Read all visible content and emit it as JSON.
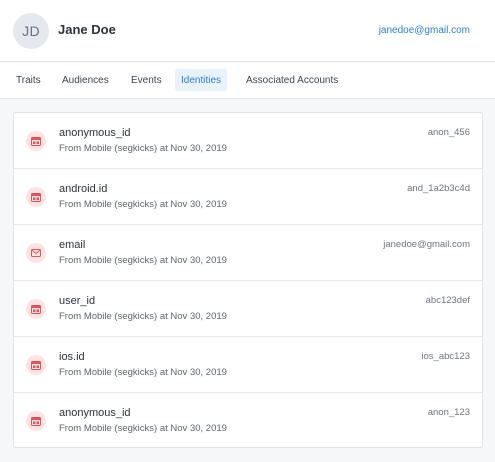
{
  "user": {
    "initials": "JD",
    "name": "Jane Doe",
    "email": "janedoe@gmail.com"
  },
  "tabs": [
    {
      "label": "Traits",
      "active": false
    },
    {
      "label": "Audiences",
      "active": false
    },
    {
      "label": "Events",
      "active": false
    },
    {
      "label": "Identities",
      "active": true
    },
    {
      "label": "Associated Accounts",
      "active": false
    }
  ],
  "identities": [
    {
      "name": "anonymous_id",
      "source_prefix": "From ",
      "source": "Mobile (segkicks)",
      "date_prefix": " at ",
      "date": "Nov 30, 2019",
      "value": "anon_456",
      "icon": "id-card-icon"
    },
    {
      "name": "android.id",
      "source_prefix": "From ",
      "source": "Mobile (segkicks)",
      "date_prefix": " at ",
      "date": "Nov 30, 2019",
      "value": "and_1a2b3c4d",
      "icon": "id-card-icon"
    },
    {
      "name": "email",
      "source_prefix": "From ",
      "source": "Mobile (segkicks)",
      "date_prefix": " at ",
      "date": "Nov 30, 2019",
      "value": "janedoe@gmail.com",
      "icon": "envelope-icon"
    },
    {
      "name": "user_id",
      "source_prefix": "From ",
      "source": "Mobile (segkicks)",
      "date_prefix": " at ",
      "date": "Nov 30, 2019",
      "value": "abc123def",
      "icon": "id-card-icon"
    },
    {
      "name": "ios.id",
      "source_prefix": "From ",
      "source": "Mobile (segkicks)",
      "date_prefix": " at ",
      "date": "Nov 30, 2019",
      "value": "ios_abc123",
      "icon": "id-card-icon"
    },
    {
      "name": "anonymous_id",
      "source_prefix": "From ",
      "source": "Mobile (segkicks)",
      "date_prefix": " at ",
      "date": "Nov 30, 2019",
      "value": "anon_123",
      "icon": "id-card-icon"
    }
  ],
  "colors": {
    "accent": "#2f80c9",
    "icon_bg": "#fce4e4",
    "icon_fg": "#e2545a"
  }
}
